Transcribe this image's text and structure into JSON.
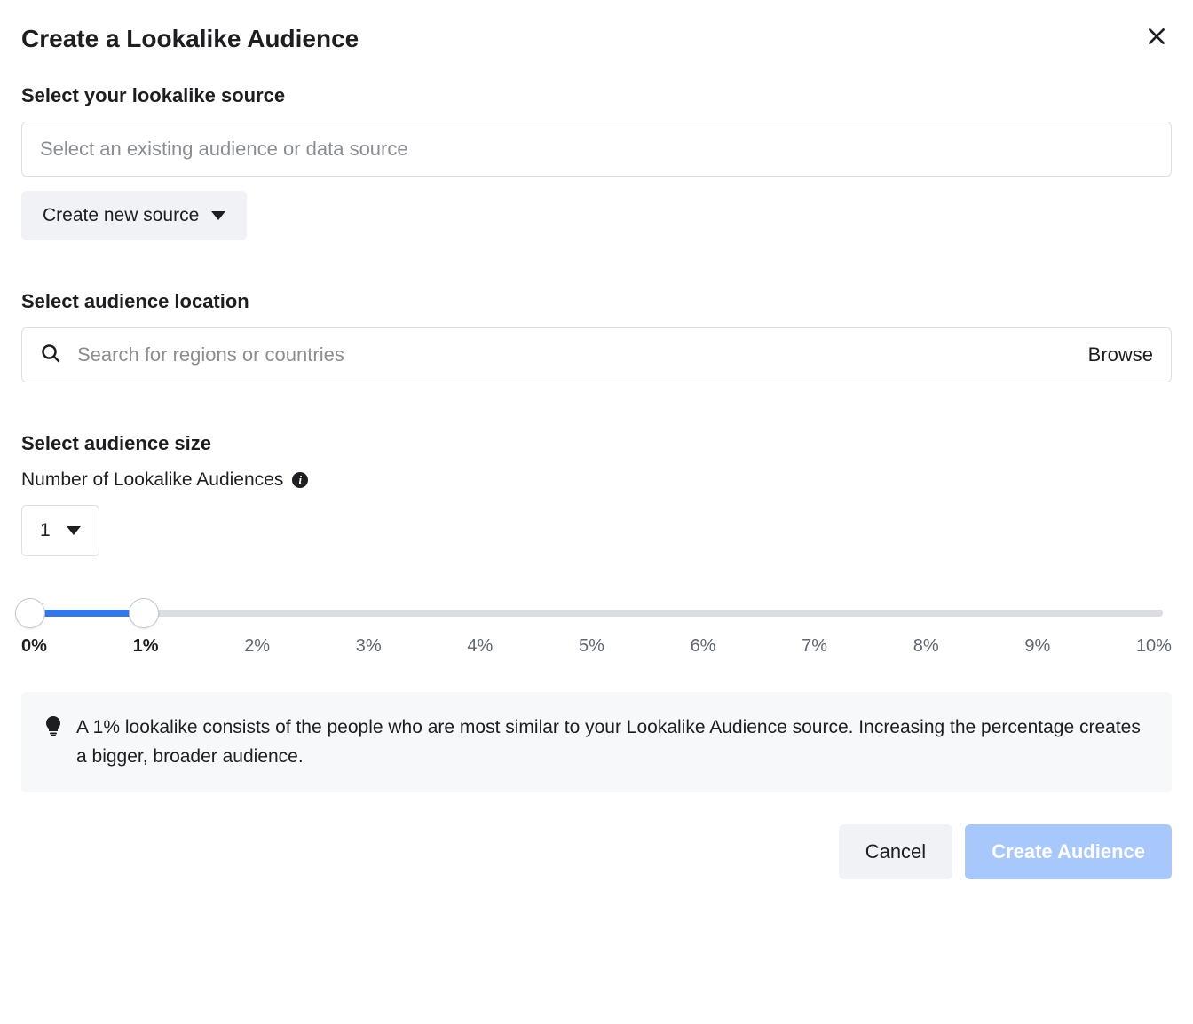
{
  "header": {
    "title": "Create a Lookalike Audience"
  },
  "source_section": {
    "label": "Select your lookalike source",
    "input_placeholder": "Select an existing audience or data source",
    "create_new_label": "Create new source"
  },
  "location_section": {
    "label": "Select audience location",
    "input_placeholder": "Search for regions or countries",
    "browse_label": "Browse"
  },
  "size_section": {
    "label": "Select audience size",
    "sub_label": "Number of Lookalike Audiences",
    "count_value": "1",
    "slider": {
      "min_percent": 0,
      "max_percent": 10,
      "range_start": 0,
      "range_end": 1,
      "ticks": [
        "0%",
        "1%",
        "2%",
        "3%",
        "4%",
        "5%",
        "6%",
        "7%",
        "8%",
        "9%",
        "10%"
      ]
    },
    "tip_text": "A 1% lookalike consists of the people who are most similar to your Lookalike Audience source. Increasing the percentage creates a bigger, broader audience."
  },
  "footer": {
    "cancel_label": "Cancel",
    "create_label": "Create Audience"
  }
}
